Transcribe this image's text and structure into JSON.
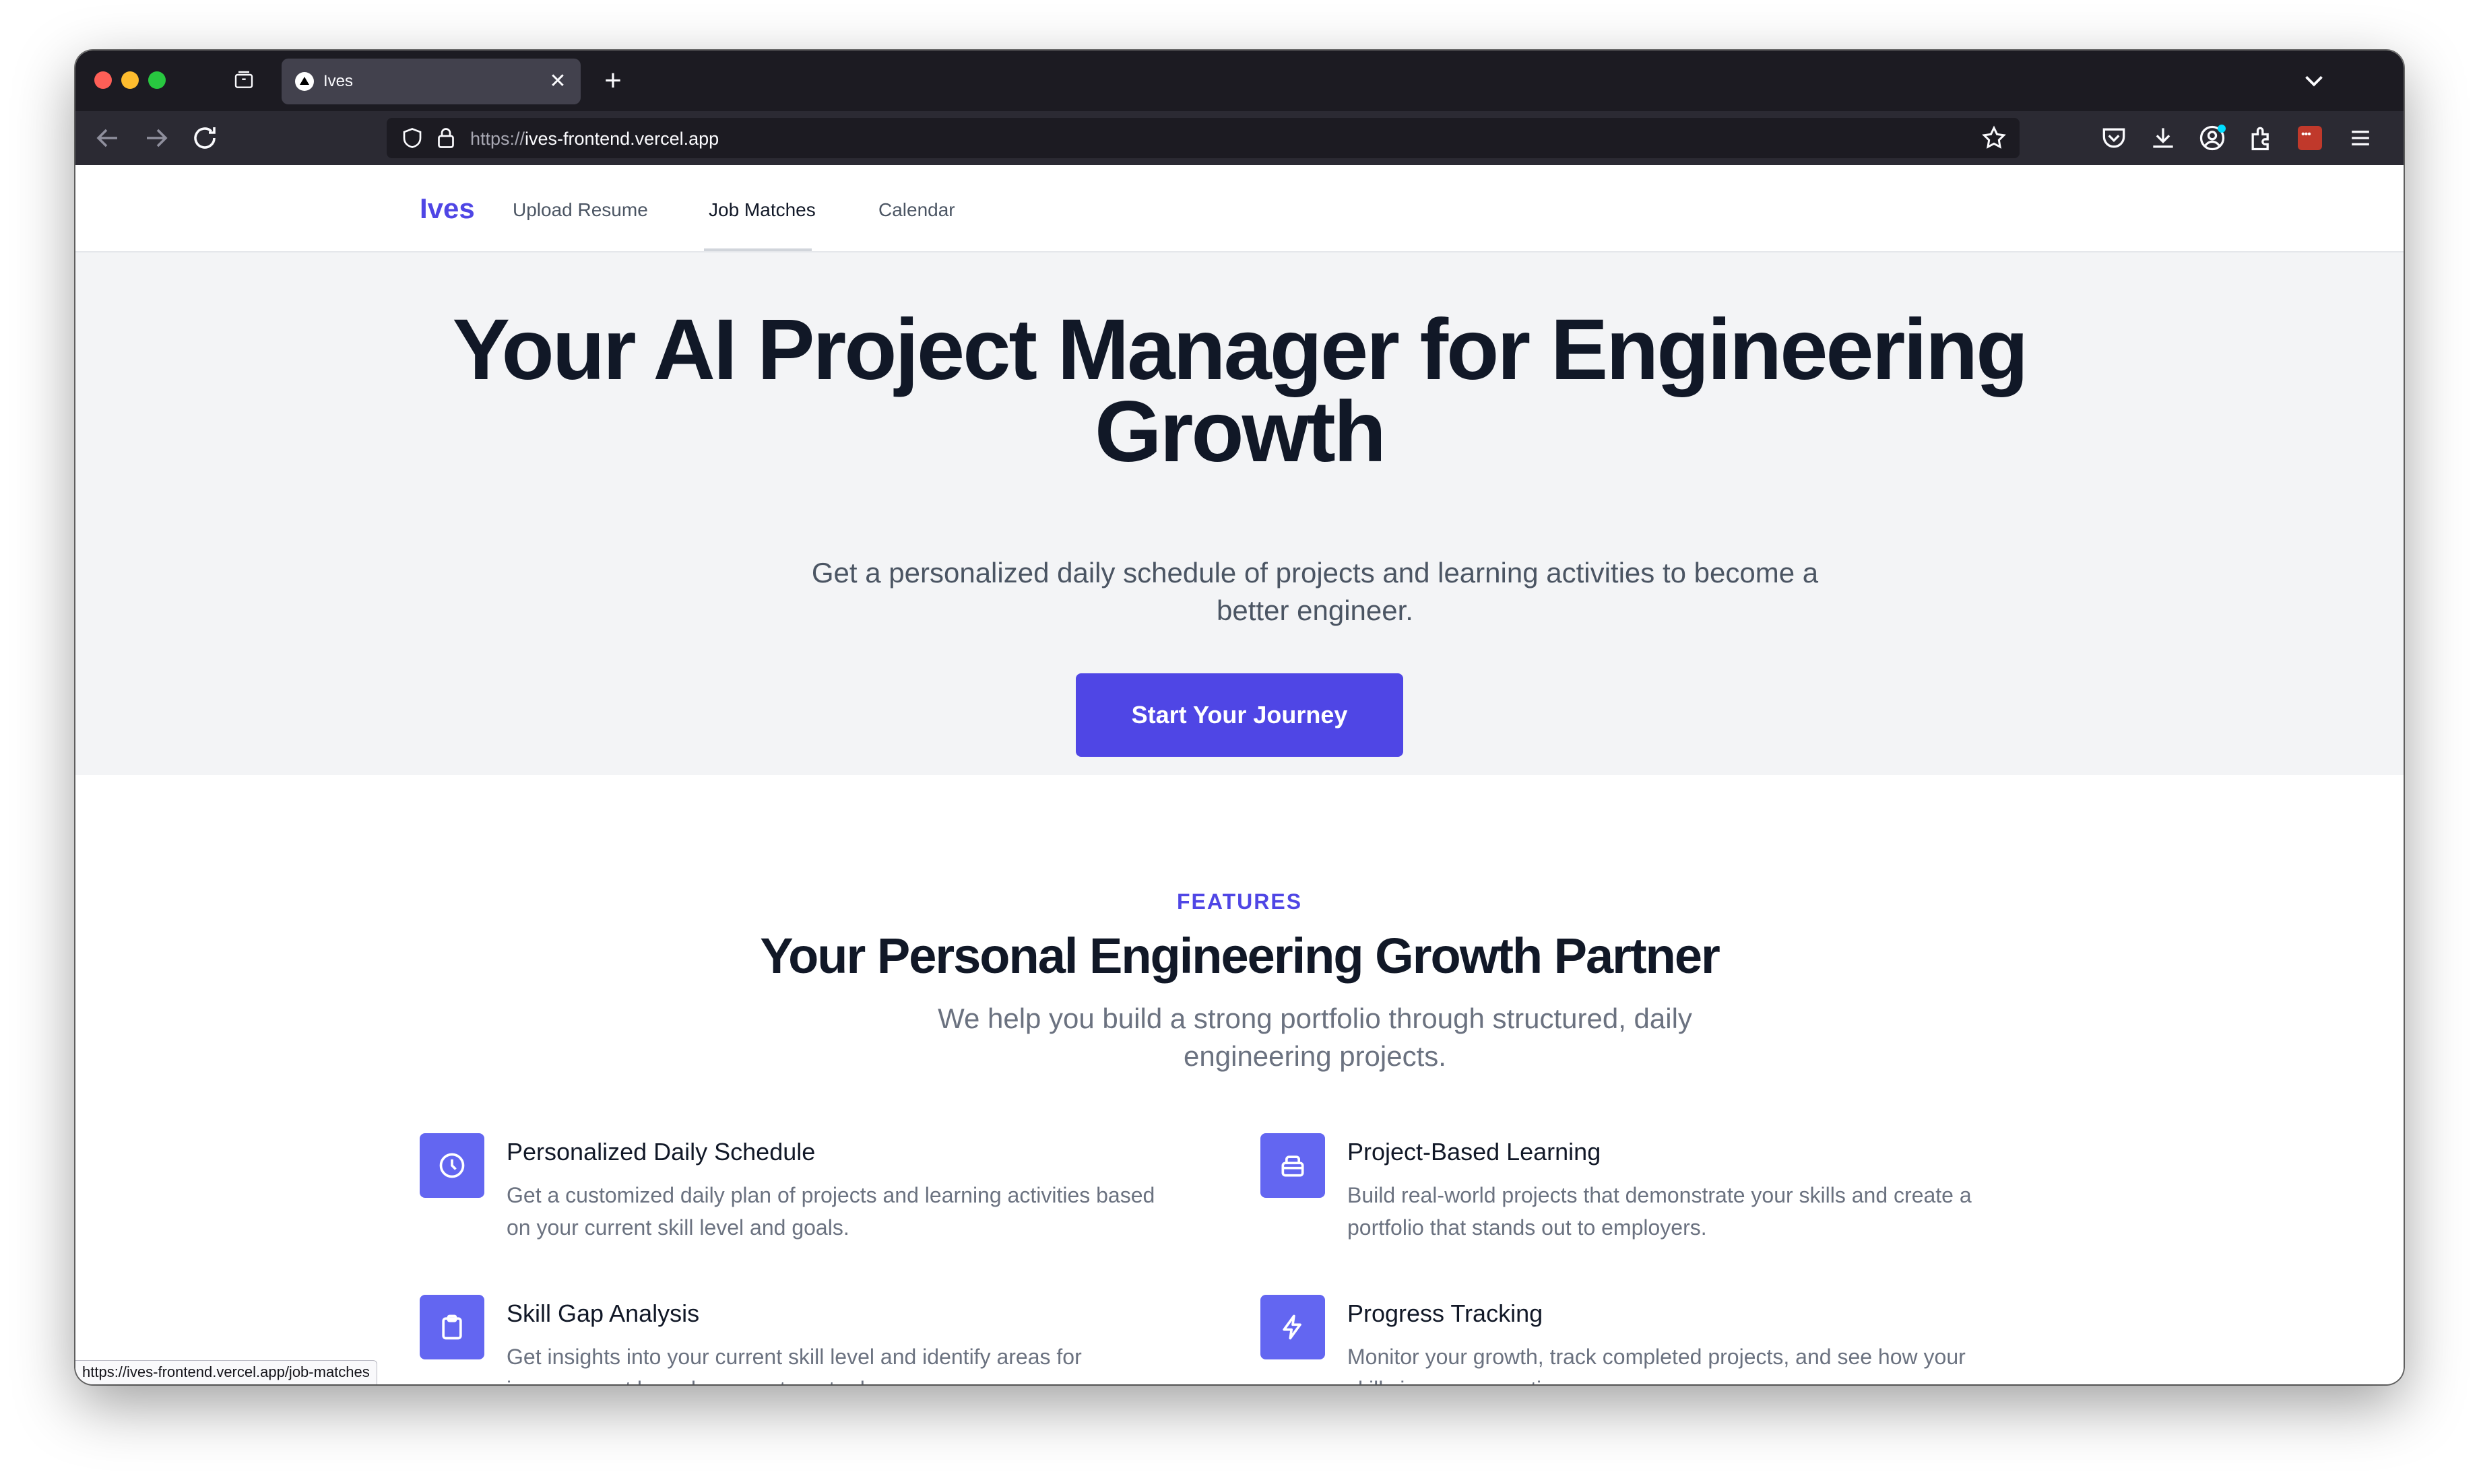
{
  "browser": {
    "tab_title": "Ives",
    "tab_close": "✕",
    "new_tab": "+",
    "url_scheme": "https://",
    "url_host": "ives-frontend.vercel.app",
    "status_url": "https://ives-frontend.vercel.app/job-matches",
    "icons": [
      "back-icon",
      "forward-icon",
      "reload-icon",
      "shield-icon",
      "lock-icon",
      "star-icon",
      "pocket-icon",
      "download-icon",
      "account-icon",
      "extensions-icon",
      "menu-icon",
      "tab-overview-icon",
      "chevron-down-icon"
    ]
  },
  "site": {
    "brand": "Ives",
    "nav": [
      {
        "label": "Upload Resume"
      },
      {
        "label": "Job Matches"
      },
      {
        "label": "Calendar"
      }
    ],
    "active_nav": "Job Matches"
  },
  "hero": {
    "title_line1": "Your AI Project Manager for Engineering",
    "title_line2": "Growth",
    "subtitle_line1": "Get a personalized daily schedule of projects and learning activities to become a",
    "subtitle_line2": "better engineer.",
    "cta_label": "Start Your Journey"
  },
  "features": {
    "eyebrow": "FEATURES",
    "title": "Your Personal Engineering Growth Partner",
    "subtitle_line1": "We help you build a strong portfolio through structured, daily",
    "subtitle_line2": "engineering projects.",
    "items": [
      {
        "icon": "clock-icon",
        "title": "Personalized Daily Schedule",
        "desc_line1": "Get a customized daily plan of projects and learning activities based",
        "desc_line2": "on your current skill level and goals."
      },
      {
        "icon": "briefcase-icon",
        "title": "Project-Based Learning",
        "desc_line1": "Build real-world projects that demonstrate your skills and create a",
        "desc_line2": "portfolio that stands out to employers."
      },
      {
        "icon": "clipboard-icon",
        "title": "Skill Gap Analysis",
        "desc_line1": "Get insights into your current skill level and identify areas for",
        "desc_line2": "improvement based on your target roles."
      },
      {
        "icon": "lightning-icon",
        "title": "Progress Tracking",
        "desc_line1": "Monitor your growth, track completed projects, and see how your",
        "desc_line2": "skills improve over time."
      }
    ]
  },
  "colors": {
    "accent": "#4f46e5",
    "icon_bg": "#6366f1",
    "hero_bg": "#f3f4f6",
    "heading": "#111827",
    "body_text": "#6b7280"
  }
}
